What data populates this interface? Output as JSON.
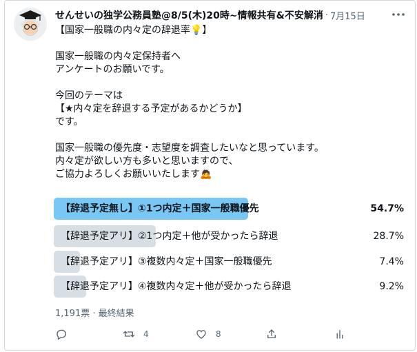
{
  "tweet": {
    "author_name": "せんせいの独学公務員塾@8/5(木)20時~情報共有&不安解消",
    "separator": "·",
    "date": "7月15日",
    "body_lines": [
      "【国家一般職の内々定の辞退率💡】",
      "",
      "国家一般職の内々定保持者へ",
      "アンケートのお願いです。",
      "",
      "今回のテーマは",
      "【★内々定を辞退する予定があるかどうか】",
      "です。",
      "",
      "国家一般職の優先度・志望度を調査したいなと思っています。",
      "内々定が欲しい方も多いと思いますので、",
      "ご協力よろしくお願いいたします🙇"
    ]
  },
  "poll": {
    "options": [
      {
        "label": "【辞退予定無し】①1つ内定＋国家一般職優先",
        "percent_text": "54.7%",
        "fraction": 0.547,
        "winner": true
      },
      {
        "label": "【辞退予定アリ】②1つ内定＋他が受かったら辞退",
        "percent_text": "28.7%",
        "fraction": 0.287,
        "winner": false
      },
      {
        "label": "【辞退予定アリ】③複数内々定＋国家一般職優先",
        "percent_text": "7.4%",
        "fraction": 0.074,
        "winner": false
      },
      {
        "label": "【辞退予定アリ】④複数内々定＋他が受かったら辞退",
        "percent_text": "9.2%",
        "fraction": 0.092,
        "winner": false
      }
    ],
    "summary": "1,191票 · 最終結果",
    "colors": {
      "winner": "#78c7f5",
      "other": "#d7dfe4"
    }
  },
  "actions": {
    "reply": {
      "icon": "reply-icon",
      "count": ""
    },
    "retweet": {
      "icon": "retweet-icon",
      "count": "4"
    },
    "like": {
      "icon": "heart-icon",
      "count": "8"
    },
    "share": {
      "icon": "share-icon",
      "count": ""
    },
    "analytics": {
      "icon": "analytics-icon",
      "count": ""
    }
  }
}
